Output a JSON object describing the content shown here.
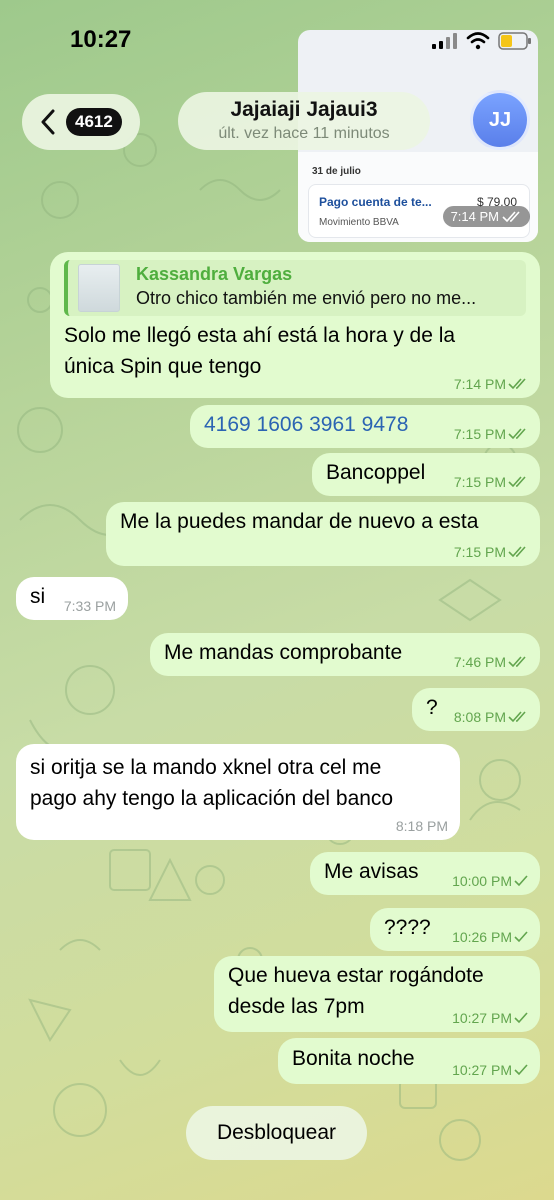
{
  "status_bar": {
    "time": "10:27"
  },
  "header": {
    "unread_count": "4612",
    "contact_name": "Jajaiaji Jajaui3",
    "last_seen": "últ. vez hace 11 minutos",
    "avatar_initials": "JJ"
  },
  "receipt": {
    "date": "31 de julio",
    "title": "Pago cuenta de te...",
    "amount": "$ 79.00",
    "subtitle": "Movimiento BBVA",
    "time": "7:14 PM"
  },
  "messages": [
    {
      "direction": "out",
      "reply_name": "Kassandra Vargas",
      "reply_text": "Otro chico también me envió pero no me...",
      "text_line1": "Solo me llegó esta ahí está la hora y de la",
      "text_line2": "única Spin que tengo",
      "time": "7:14 PM",
      "status": "read"
    },
    {
      "direction": "out",
      "text": "4169 1606 3961 9478",
      "time": "7:15 PM",
      "status": "read"
    },
    {
      "direction": "out",
      "text": "Bancoppel",
      "time": "7:15 PM",
      "status": "read"
    },
    {
      "direction": "out",
      "text": "Me la puedes mandar de nuevo a esta",
      "time": "7:15 PM",
      "status": "read"
    },
    {
      "direction": "in",
      "text": "si",
      "time": "7:33 PM"
    },
    {
      "direction": "out",
      "text": "Me mandas comprobante",
      "time": "7:46 PM",
      "status": "read"
    },
    {
      "direction": "out",
      "text": "?",
      "time": "8:08 PM",
      "status": "read"
    },
    {
      "direction": "in",
      "text_line1": "si oritja se la mando xknel otra cel me",
      "text_line2": "pago ahy tengo la aplicación del banco",
      "time": "8:18 PM"
    },
    {
      "direction": "out",
      "text": "Me avisas",
      "time": "10:00 PM",
      "status": "sent"
    },
    {
      "direction": "out",
      "text": "????",
      "time": "10:26 PM",
      "status": "sent"
    },
    {
      "direction": "out",
      "text_line1": "Que hueva estar rogándote",
      "text_line2": "desde las 7pm",
      "time": "10:27 PM",
      "status": "sent"
    },
    {
      "direction": "out",
      "text": "Bonita noche",
      "time": "10:27 PM",
      "status": "sent"
    }
  ],
  "unblock_label": "Desbloquear",
  "colors": {
    "outgoing_bubble": "#e2fbcf",
    "incoming_bubble": "#ffffff",
    "check": "#62a54e",
    "link": "#2b64b3"
  },
  "icons": [
    "back-chevron-icon",
    "cellular-signal-icon",
    "wifi-icon",
    "battery-icon",
    "double-check-icon",
    "single-check-icon"
  ]
}
